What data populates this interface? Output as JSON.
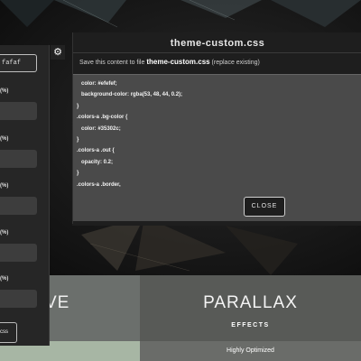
{
  "modal": {
    "title": "theme-custom.css",
    "instruction_prefix": "Save this content to file",
    "instruction_file": "theme-custom.css",
    "instruction_suffix": "(replace existing)",
    "code_lines": [
      "color: #efefef;",
      "background-color: rgba(53, 48, 44, 0.2);",
      "}",
      ".colors-a .bg-color {",
      "color: #35302c;",
      "}",
      ".colors-a .out {",
      "opacity: 0.2;",
      "}",
      ".colors-a .border,"
    ],
    "close_label": "CLOSE"
  },
  "panel": {
    "swatch_value": "fafaf",
    "labels": [
      "(%)",
      "(%)",
      "(%)",
      "(%)",
      "(%)"
    ],
    "css_button_label": "css",
    "cog_icon": "cogs-icon"
  },
  "tiles": {
    "left_big": "VE",
    "right_big": "PARALLAX",
    "right_small": "EFFECTS",
    "right_strip": "Highly Optimized"
  }
}
